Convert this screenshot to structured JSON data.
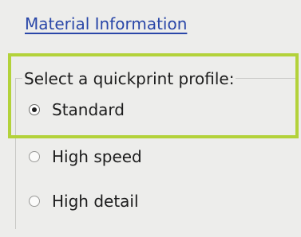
{
  "material_link": "Material Information",
  "profile_group": {
    "legend": "Select a quickprint profile:",
    "options": [
      {
        "label": "Standard",
        "selected": true
      },
      {
        "label": "High speed",
        "selected": false
      },
      {
        "label": "High detail",
        "selected": false
      }
    ]
  },
  "colors": {
    "link": "#2a47a8",
    "highlight": "#b3d23a",
    "background": "#ededeb"
  }
}
